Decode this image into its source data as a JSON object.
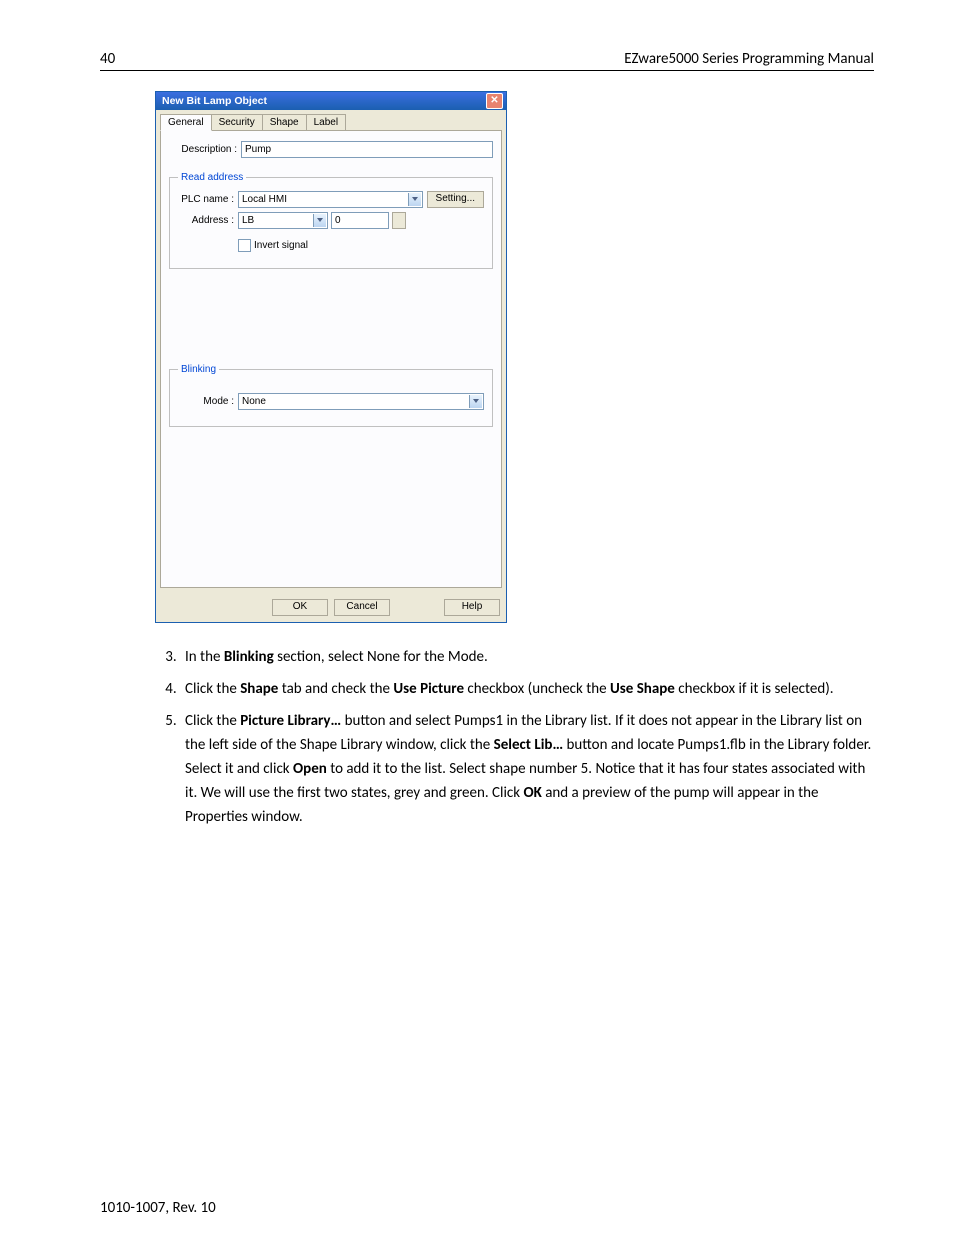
{
  "header": {
    "page_number": "40",
    "manual_title": "EZware5000 Series Programming Manual"
  },
  "dialog": {
    "title": "New  Bit Lamp Object",
    "tabs": [
      "General",
      "Security",
      "Shape",
      "Label"
    ],
    "description_label": "Description :",
    "description_value": "Pump",
    "read_address": {
      "legend": "Read address",
      "plc_label": "PLC name :",
      "plc_value": "Local HMI",
      "setting_btn": "Setting...",
      "address_label": "Address :",
      "address_type": "LB",
      "address_value": "0",
      "invert_label": "Invert signal"
    },
    "blinking": {
      "legend": "Blinking",
      "mode_label": "Mode :",
      "mode_value": "None"
    },
    "buttons": {
      "ok": "OK",
      "cancel": "Cancel",
      "help": "Help"
    }
  },
  "steps": {
    "s3_a": "In the ",
    "s3_b": "Blinking",
    "s3_c": " section, select None for the Mode.",
    "s4_a": "Click the ",
    "s4_b": "Shape",
    "s4_c": " tab and check the ",
    "s4_d": "Use Picture",
    "s4_e": " checkbox (uncheck the ",
    "s4_f": "Use Shape",
    "s4_g": " checkbox if it is selected).",
    "s5_a": "Click the ",
    "s5_b": "Picture Library…",
    "s5_c": " button and select Pumps1 in the Library list. If it does not appear in the Library list on the left side of the Shape Library window, click the ",
    "s5_d": "Select Lib…",
    "s5_e": " button and locate Pumps1.flb in the Library folder. Select it and click ",
    "s5_f": "Open",
    "s5_g": " to add it to the list. Select shape number 5. Notice that it has four states associated with it. We will use the first two states, grey and green. Click ",
    "s5_h": "OK",
    "s5_i": " and a preview of the pump will appear in the Properties window."
  },
  "footer": {
    "rev": "1010-1007, Rev. 10"
  }
}
